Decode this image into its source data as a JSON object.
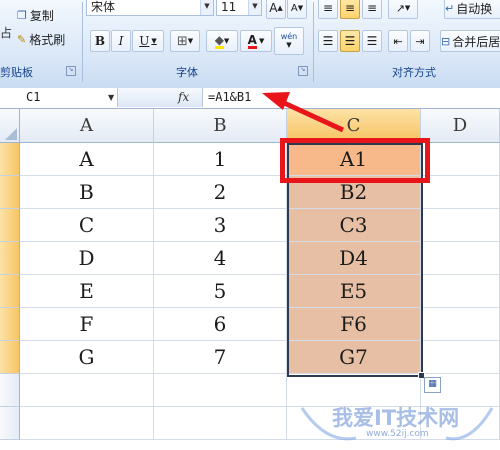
{
  "ribbon": {
    "clipboard": {
      "copy_label": "复制",
      "format_painter_label": "格式刷",
      "paste_fragment": "占",
      "group_label": "剪贴板"
    },
    "font": {
      "font_name": "宋体",
      "font_size": "11",
      "bold": "B",
      "italic": "I",
      "underline": "U",
      "font_color_letter": "A",
      "phonetic_label": "wén",
      "group_label": "字体"
    },
    "alignment": {
      "wrap_label": "自动换",
      "merge_label": "合并后居",
      "group_label": "对齐方式"
    }
  },
  "formula_bar": {
    "name_box": "C1",
    "fx_label": "fx",
    "formula": "=A1&B1"
  },
  "columns": [
    "A",
    "B",
    "C",
    "D"
  ],
  "rows": [
    {
      "a": "A",
      "b": "1",
      "c": "A1"
    },
    {
      "a": "B",
      "b": "2",
      "c": "B2"
    },
    {
      "a": "C",
      "b": "3",
      "c": "C3"
    },
    {
      "a": "D",
      "b": "4",
      "c": "D4"
    },
    {
      "a": "E",
      "b": "5",
      "c": "E5"
    },
    {
      "a": "F",
      "b": "6",
      "c": "F6"
    },
    {
      "a": "G",
      "b": "7",
      "c": "G7"
    }
  ],
  "watermark": {
    "text": "我爱IT技术网",
    "url": "www.52ij.com"
  },
  "colors": {
    "selection_fill": "#e6bfa4",
    "active_cell_fill": "#f7b98a",
    "highlight_red": "#e8161b",
    "header_selected": "#f7c463"
  }
}
